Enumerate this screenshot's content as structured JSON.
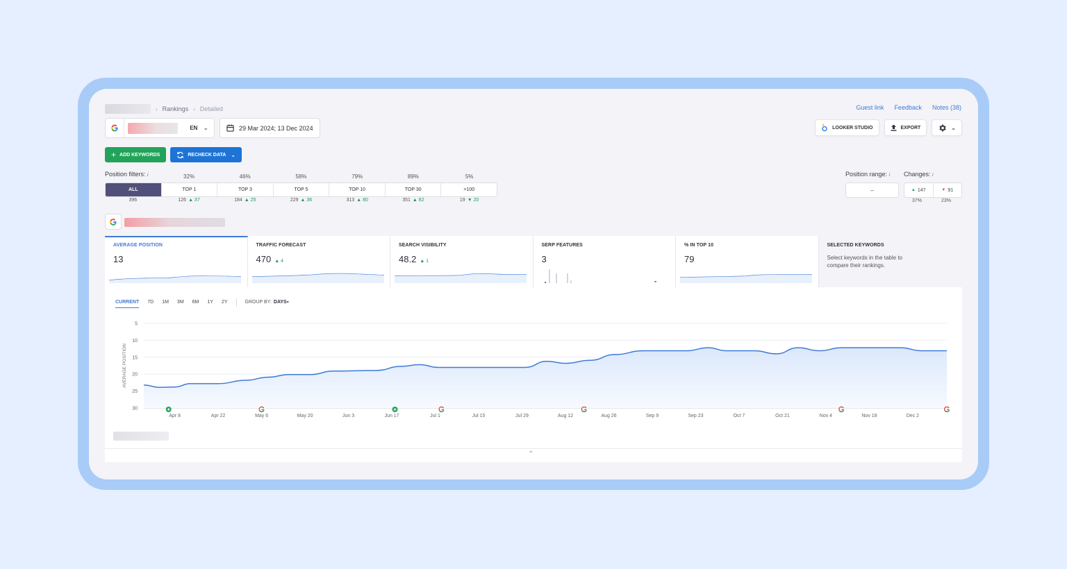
{
  "breadcrumb": {
    "items": [
      "Rankings",
      "Detailed"
    ]
  },
  "header_links": [
    "Guest link",
    "Feedback",
    "Notes (38)"
  ],
  "project": {
    "language": "EN",
    "date_range": "29 Mar 2024; 13 Dec 2024"
  },
  "tools": {
    "looker_label": "LOOKER STUDIO",
    "export_label": "EXPORT"
  },
  "actions": {
    "add_keywords": "ADD KEYWORDS",
    "recheck_data": "RECHECK DATA"
  },
  "position_filters": {
    "label": "Position filters:",
    "tabs": [
      {
        "label": "ALL",
        "pct": "",
        "count": "396",
        "delta": ""
      },
      {
        "label": "TOP 1",
        "pct": "32%",
        "count": "126",
        "delta": "▲ 37"
      },
      {
        "label": "TOP 3",
        "pct": "46%",
        "count": "184",
        "delta": "▲ 25"
      },
      {
        "label": "TOP 5",
        "pct": "58%",
        "count": "229",
        "delta": "▲ 36"
      },
      {
        "label": "TOP 10",
        "pct": "79%",
        "count": "313",
        "delta": "▲ 80"
      },
      {
        "label": "TOP 30",
        "pct": "89%",
        "count": "351",
        "delta": "▲ 82"
      },
      {
        "label": ">100",
        "pct": "5%",
        "count": "19",
        "delta": "▼ 20"
      }
    ]
  },
  "position_range": {
    "label": "Position range:",
    "value": "–"
  },
  "changes": {
    "label": "Changes:",
    "up": "147",
    "down": "91",
    "up_pct": "37%",
    "down_pct": "23%"
  },
  "metrics": [
    {
      "title": "AVERAGE POSITION",
      "value": "13",
      "delta": ""
    },
    {
      "title": "TRAFFIC FORECAST",
      "value": "470",
      "delta": "▲ 4"
    },
    {
      "title": "SEARCH VISIBILITY",
      "value": "48.2",
      "delta": "▲ 1"
    },
    {
      "title": "SERP FEATURES",
      "value": "3",
      "delta": ""
    },
    {
      "title": "% IN TOP 10",
      "value": "79",
      "delta": ""
    },
    {
      "title": "SELECTED KEYWORDS",
      "desc": "Select keywords in the table to compare their rankings."
    }
  ],
  "chart_controls": {
    "ranges": [
      "CURRENT",
      "7D",
      "1M",
      "3M",
      "6M",
      "1Y",
      "2Y"
    ],
    "group_by_label": "GROUP BY:",
    "group_by_value": "DAYS"
  },
  "chart_data": {
    "type": "line",
    "ylabel": "AVERAGE POSITION",
    "y_ticks": [
      5,
      10,
      15,
      20,
      25,
      30
    ],
    "ylim": [
      5,
      30
    ],
    "y_reversed": true,
    "x_ticks": [
      "Apr 8",
      "Apr 22",
      "May 6",
      "May 20",
      "Jun 3",
      "Jun 17",
      "Jul 1",
      "Jul 15",
      "Jul 29",
      "Aug 12",
      "Aug 26",
      "Sep 9",
      "Sep 23",
      "Oct 7",
      "Oct 21",
      "Nov 4",
      "Nov 18",
      "Dec 2"
    ],
    "x_start": "2024-03-29",
    "x_end": "2024-12-13",
    "series": [
      {
        "points": [
          [
            "2024-03-29",
            23.2
          ],
          [
            "2024-04-03",
            23.9
          ],
          [
            "2024-04-08",
            23.8
          ],
          [
            "2024-04-13",
            22.8
          ],
          [
            "2024-04-22",
            22.8
          ],
          [
            "2024-05-01",
            21.8
          ],
          [
            "2024-05-08",
            20.9
          ],
          [
            "2024-05-15",
            20.1
          ],
          [
            "2024-05-22",
            20.1
          ],
          [
            "2024-05-29",
            19.1
          ],
          [
            "2024-06-12",
            18.9
          ],
          [
            "2024-06-20",
            17.7
          ],
          [
            "2024-06-26",
            17.2
          ],
          [
            "2024-07-02",
            18.0
          ],
          [
            "2024-07-30",
            18.0
          ],
          [
            "2024-08-06",
            16.2
          ],
          [
            "2024-08-12",
            16.8
          ],
          [
            "2024-08-20",
            15.9
          ],
          [
            "2024-08-28",
            14.2
          ],
          [
            "2024-09-06",
            13.1
          ],
          [
            "2024-09-20",
            13.1
          ],
          [
            "2024-09-27",
            12.2
          ],
          [
            "2024-10-03",
            13.1
          ],
          [
            "2024-10-12",
            13.1
          ],
          [
            "2024-10-19",
            14.0
          ],
          [
            "2024-10-26",
            12.2
          ],
          [
            "2024-11-02",
            13.1
          ],
          [
            "2024-11-09",
            12.2
          ],
          [
            "2024-11-28",
            12.2
          ],
          [
            "2024-12-05",
            13.1
          ],
          [
            "2024-12-13",
            13.1
          ]
        ]
      }
    ],
    "event_markers": [
      {
        "date": "2024-04-06",
        "kind": "green"
      },
      {
        "date": "2024-05-06",
        "kind": "google"
      },
      {
        "date": "2024-06-18",
        "kind": "green"
      },
      {
        "date": "2024-07-03",
        "kind": "google"
      },
      {
        "date": "2024-08-18",
        "kind": "google"
      },
      {
        "date": "2024-11-09",
        "kind": "google"
      },
      {
        "date": "2024-12-13",
        "kind": "google"
      }
    ],
    "grid": true
  }
}
